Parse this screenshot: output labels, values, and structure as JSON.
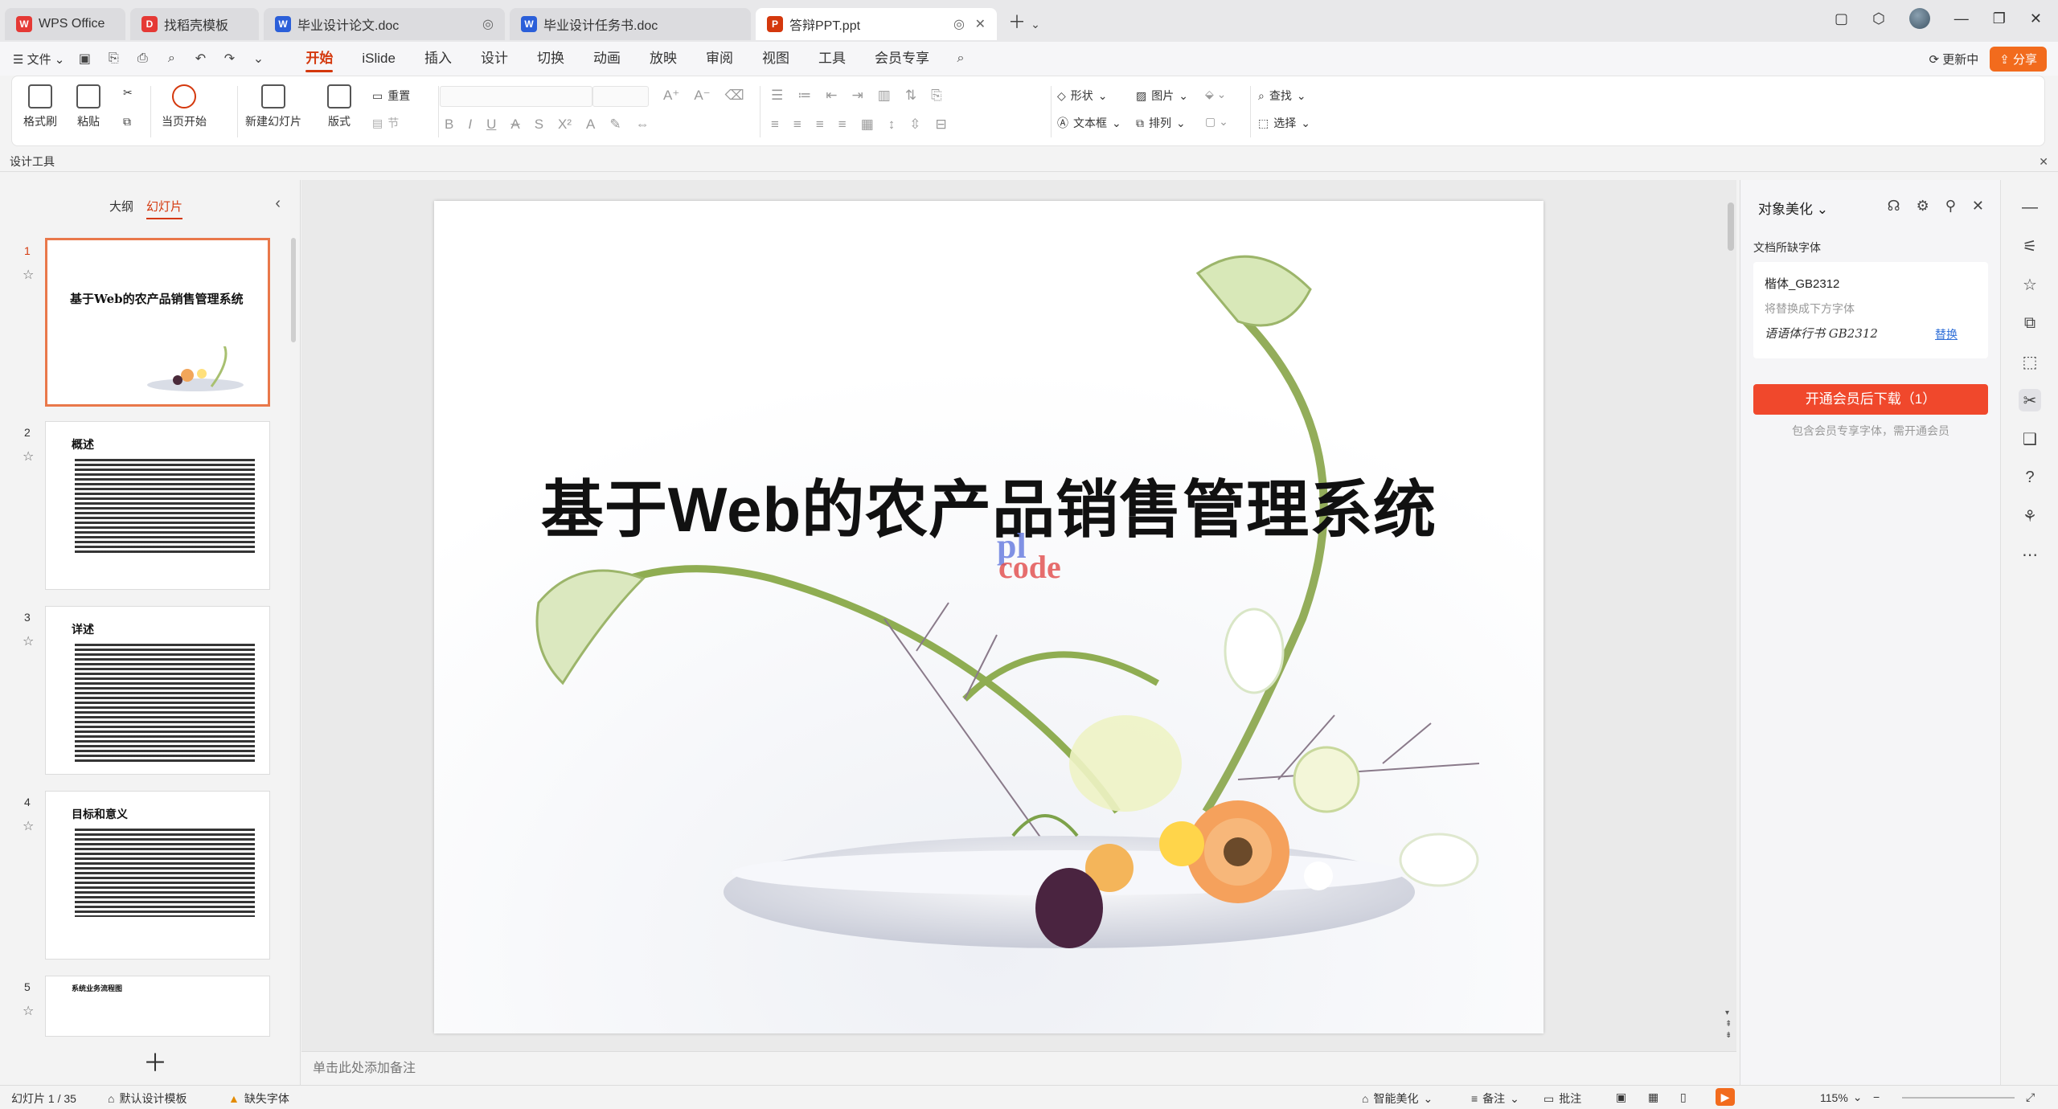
{
  "tabs": [
    {
      "label": "WPS Office",
      "icon": "wps-logo-icon",
      "color": "#e53935"
    },
    {
      "label": "找稻壳模板",
      "icon": "docer-icon",
      "color": "#e53935"
    },
    {
      "label": "毕业设计论文.doc",
      "icon": "word-doc-icon",
      "color": "#2b5fd9"
    },
    {
      "label": "毕业设计任务书.doc",
      "icon": "word-doc-icon",
      "color": "#2b5fd9"
    },
    {
      "label": "答辩PPT.ppt",
      "icon": "ppt-icon",
      "color": "#d4380d",
      "active": true
    }
  ],
  "menu": {
    "file": "文件",
    "tabs": [
      "开始",
      "iSlide",
      "插入",
      "设计",
      "切换",
      "动画",
      "放映",
      "审阅",
      "视图",
      "工具",
      "会员专享"
    ],
    "active_tab": "开始",
    "update": "更新中",
    "share": "分享"
  },
  "ribbon": {
    "format_painter": "格式刷",
    "paste": "粘贴",
    "play_from_current": "当页开始",
    "new_slide": "新建幻灯片",
    "layout": "版式",
    "reset": "重置",
    "section": "节",
    "shape": "形状",
    "picture": "图片",
    "textbox": "文本框",
    "arrange": "排列",
    "find": "查找",
    "select": "选择"
  },
  "design_tools": "设计工具",
  "left_panel": {
    "tab_outline": "大纲",
    "tab_slides": "幻灯片",
    "slides": [
      {
        "num": "1",
        "title": "基于Web的农产品销售管理系统",
        "selected": true
      },
      {
        "num": "2",
        "title": "概述"
      },
      {
        "num": "3",
        "title": "详述"
      },
      {
        "num": "4",
        "title": "目标和意义"
      },
      {
        "num": "5",
        "title": "系统业务流程图"
      }
    ]
  },
  "slide": {
    "title_prefix": "基于",
    "title_web": "Web",
    "title_suffix": "的农产品销售管理系统",
    "watermark_top": "pl",
    "watermark_bottom": "code"
  },
  "notes_placeholder": "单击此处添加备注",
  "right_panel": {
    "title": "对象美化",
    "missing_fonts_label": "文档所缺字体",
    "font_name": "楷体_GB2312",
    "replace_hint": "将替换成下方字体",
    "sample_font": "语语体行书 GB2312",
    "replace_link": "替换",
    "vip_button": "开通会员后下载（1）",
    "vip_hint": "包含会员专享字体，需开通会员"
  },
  "status": {
    "slide_counter": "幻灯片 1 / 35",
    "template": "默认设计模板",
    "missing_font": "缺失字体",
    "smart_beautify": "智能美化",
    "notes": "备注",
    "comments": "批注",
    "zoom": "115%"
  }
}
